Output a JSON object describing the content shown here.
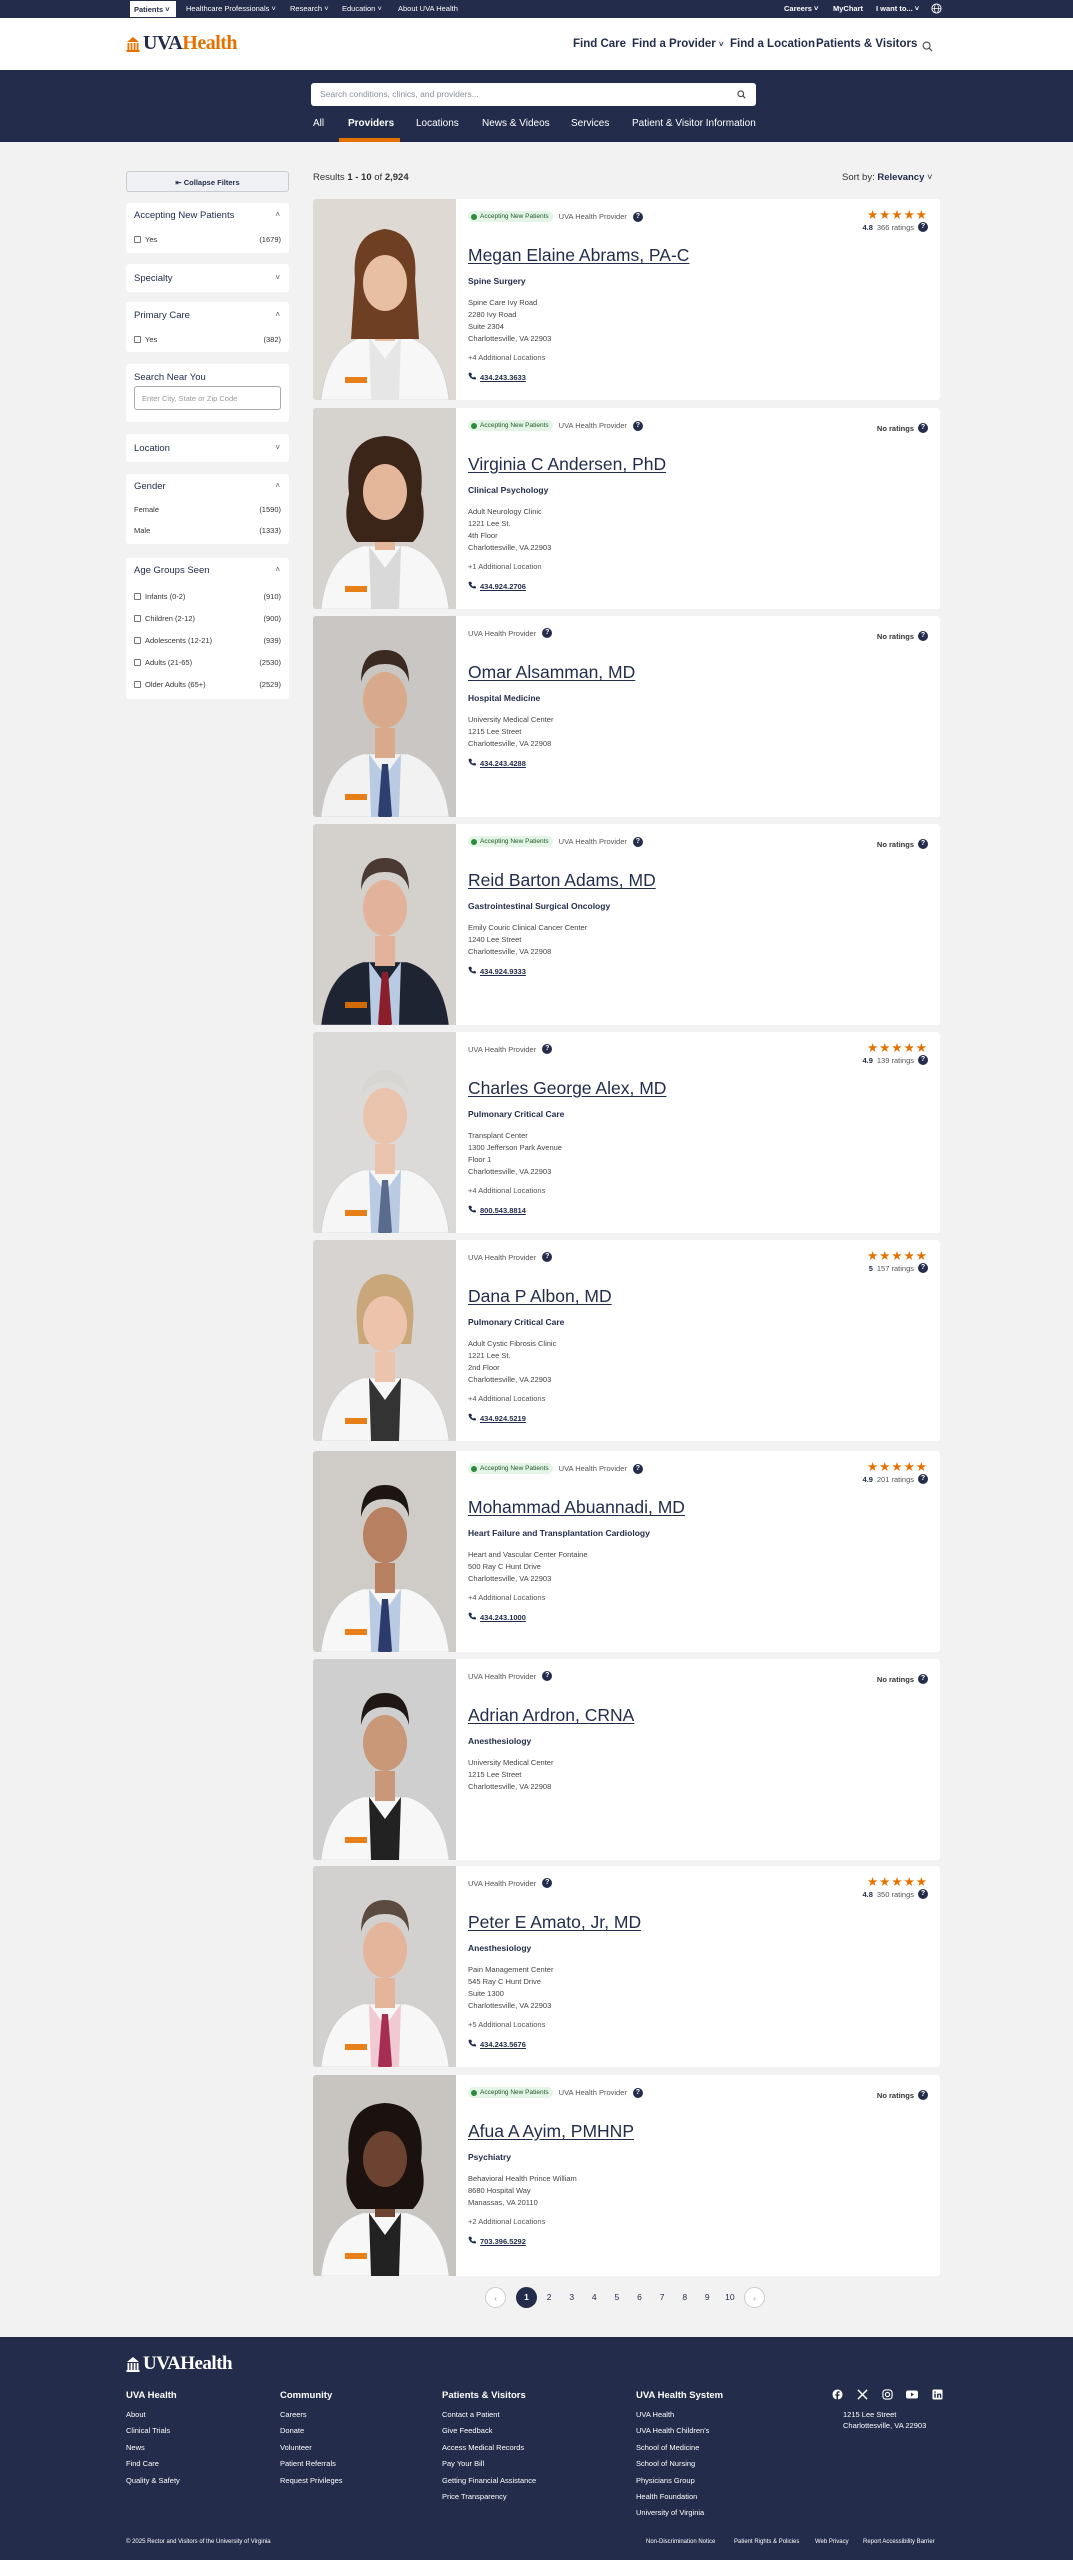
{
  "utility": {
    "patients": "Patients",
    "professionals": "Healthcare Professionals",
    "research": "Research",
    "education": "Education",
    "about": "About UVA Health",
    "careers": "Careers",
    "mychart": "MyChart",
    "want": "I want to..."
  },
  "header": {
    "logo_a": "UVA",
    "logo_b": "Health",
    "nav": [
      "Find Care",
      "Find a Provider",
      "Find a Location",
      "Patients & Visitors"
    ]
  },
  "search": {
    "placeholder": "Search conditions, clinics, and providers..."
  },
  "tabs": [
    "All",
    "Providers",
    "Locations",
    "News & Videos",
    "Services",
    "Patient & Visitor Information"
  ],
  "sidebar": {
    "collapse": "Collapse Filters",
    "accepting": {
      "title": "Accepting New Patients",
      "options": [
        {
          "label": "Yes",
          "count": "(1679)"
        }
      ]
    },
    "specialty": "Specialty",
    "primary": {
      "title": "Primary Care",
      "options": [
        {
          "label": "Yes",
          "count": "(382)"
        }
      ]
    },
    "near": {
      "title": "Search Near You",
      "placeholder": "Enter City, State or Zip Code"
    },
    "location": "Location",
    "gender": {
      "title": "Gender",
      "options": [
        {
          "label": "Female",
          "count": "(1590)"
        },
        {
          "label": "Male",
          "count": "(1333)"
        }
      ]
    },
    "age": {
      "title": "Age Groups Seen",
      "options": [
        {
          "label": "Infants (0-2)",
          "count": "(910)"
        },
        {
          "label": "Children (2-12)",
          "count": "(900)"
        },
        {
          "label": "Adolescents (12-21)",
          "count": "(939)"
        },
        {
          "label": "Adults (21-65)",
          "count": "(2530)"
        },
        {
          "label": "Older Adults (65+)",
          "count": "(2529)"
        }
      ]
    }
  },
  "results": {
    "prefix": "Results ",
    "range": "1 - 10",
    "of": " of ",
    "total": "2,924",
    "sort_label": "Sort by: ",
    "sort_value": "Relevancy"
  },
  "provider_label": "UVA Health Provider",
  "accepting_label": "Accepting New Patients",
  "no_ratings": "No ratings",
  "providers": [
    {
      "name": "Megan Elaine Abrams, PA-C",
      "specialty": "Spine Surgery",
      "accepting": true,
      "address": [
        "Spine Care Ivy Road",
        "2280 Ivy Road",
        "Suite 2304",
        "Charlottesville, VA 22903"
      ],
      "additional": "+4 Additional Locations",
      "phone": "434.243.3633",
      "rating": "4.8",
      "ratings": "366 ratings"
    },
    {
      "name": "Virginia C Andersen, PhD",
      "specialty": "Clinical Psychology",
      "accepting": true,
      "address": [
        "Adult Neurology Clinic",
        "1221 Lee St.",
        "4th Floor",
        "Charlottesville, VA 22903"
      ],
      "additional": "+1 Additional Location",
      "phone": "434.924.2706",
      "rating": "",
      "ratings": ""
    },
    {
      "name": "Omar Alsamman, MD",
      "specialty": "Hospital Medicine",
      "accepting": false,
      "address": [
        "University Medical Center",
        "1215 Lee Street",
        "Charlottesville, VA 22908"
      ],
      "additional": "",
      "phone": "434.243.4288",
      "rating": "",
      "ratings": ""
    },
    {
      "name": "Reid Barton Adams, MD",
      "specialty": "Gastrointestinal Surgical Oncology",
      "accepting": true,
      "address": [
        "Emily Couric Clinical Cancer Center",
        "1240 Lee Street",
        "Charlottesville, VA 22908"
      ],
      "additional": "",
      "phone": "434.924.9333",
      "rating": "",
      "ratings": ""
    },
    {
      "name": "Charles George Alex, MD",
      "specialty": "Pulmonary Critical Care",
      "accepting": false,
      "address": [
        "Transplant Center",
        "1300 Jefferson Park Avenue",
        "Floor 1",
        "Charlottesville, VA 22903"
      ],
      "additional": "+4 Additional Locations",
      "phone": "800.543.8814",
      "rating": "4.9",
      "ratings": "139 ratings"
    },
    {
      "name": "Dana P Albon, MD",
      "specialty": "Pulmonary Critical Care",
      "accepting": false,
      "address": [
        "Adult Cystic Fibrosis Clinic",
        "1221 Lee St.",
        "2nd Floor",
        "Charlottesville, VA 22903"
      ],
      "additional": "+4 Additional Locations",
      "phone": "434.924.5219",
      "rating": "5",
      "ratings": "157 ratings"
    },
    {
      "name": "Mohammad Abuannadi, MD",
      "specialty": "Heart Failure and Transplantation Cardiology",
      "accepting": true,
      "address": [
        "Heart and Vascular Center Fontaine",
        "500 Ray C Hunt Drive",
        "Charlottesville, VA 22903"
      ],
      "additional": "+4 Additional Locations",
      "phone": "434.243.1000",
      "rating": "4.9",
      "ratings": "201 ratings"
    },
    {
      "name": "Adrian Ardron, CRNA",
      "specialty": "Anesthesiology",
      "accepting": false,
      "address": [
        "University Medical Center",
        "1215 Lee Street",
        "Charlottesville, VA 22908"
      ],
      "additional": "",
      "phone": "",
      "rating": "",
      "ratings": ""
    },
    {
      "name": "Peter E Amato, Jr, MD",
      "specialty": "Anesthesiology",
      "accepting": false,
      "address": [
        "Pain Management Center",
        "545 Ray C Hunt Drive",
        "Suite 1300",
        "Charlottesville, VA 22903"
      ],
      "additional": "+5 Additional Locations",
      "phone": "434.243.5676",
      "rating": "4.8",
      "ratings": "350 ratings"
    },
    {
      "name": "Afua A Ayim, PMHNP",
      "specialty": "Psychiatry",
      "accepting": true,
      "address": [
        "Behavioral Health Prince William",
        "8680 Hospital Way",
        "Manassas, VA 20110"
      ],
      "additional": "+2 Additional Locations",
      "phone": "703.396.5292",
      "rating": "",
      "ratings": ""
    }
  ],
  "pagination": [
    "1",
    "2",
    "3",
    "4",
    "5",
    "6",
    "7",
    "8",
    "9",
    "10"
  ],
  "footer": {
    "logo_a": "UVA",
    "logo_b": "Health",
    "cols": [
      {
        "title": "UVA Health",
        "links": [
          "About",
          "Clinical Trials",
          "News",
          "Find Care",
          "Quality & Safety"
        ]
      },
      {
        "title": "Community",
        "links": [
          "Careers",
          "Donate",
          "Volunteer",
          "Patient Referrals",
          "Request Privileges"
        ]
      },
      {
        "title": "Patients & Visitors",
        "links": [
          "Contact a Patient",
          "Give Feedback",
          "Access Medical Records",
          "Pay Your Bill",
          "Getting Financial Assistance",
          "Price Transparency"
        ]
      },
      {
        "title": "UVA Health System",
        "links": [
          "UVA Health",
          "UVA Health Children's",
          "School of Medicine",
          "School of Nursing",
          "Physicians Group",
          "Health Foundation",
          "University of Virginia"
        ]
      }
    ],
    "address": [
      "1215 Lee Street",
      "Charlottesville, VA 22903"
    ],
    "copyright": "© 2025 Rector and Visitors of the University of Virginia",
    "legal": [
      "Non-Discrimination Notice",
      "Patient Rights & Policies",
      "Web Privacy",
      "Report Accessibility Barrier"
    ]
  },
  "colors": {
    "navy": "#232d4b",
    "orange": "#e57200",
    "green": "#2e8b3e"
  }
}
